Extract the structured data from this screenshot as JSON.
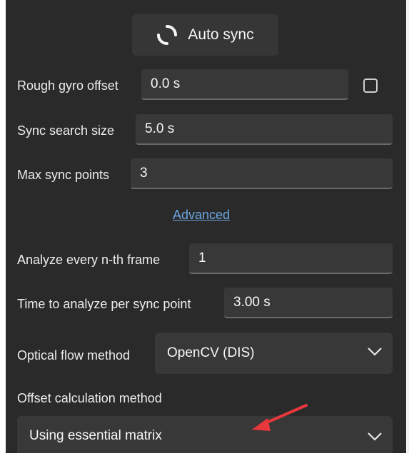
{
  "auto_sync": {
    "label": "Auto sync",
    "icon": "sync-spinner-icon"
  },
  "rough_gyro_offset": {
    "label": "Rough gyro offset",
    "value": "0.0 s"
  },
  "sync_search_size": {
    "label": "Sync search size",
    "value": "5.0 s"
  },
  "max_sync_points": {
    "label": "Max sync points",
    "value": "3"
  },
  "advanced": {
    "label": "Advanced"
  },
  "analyze_every": {
    "label": "Analyze every n-th frame",
    "value": "1"
  },
  "time_per_point": {
    "label": "Time to analyze per sync point",
    "value": "3.00 s"
  },
  "optical_flow": {
    "label": "Optical flow method",
    "selected": "OpenCV (DIS)"
  },
  "offset_calc": {
    "label": "Offset calculation method",
    "selected": "Using essential matrix"
  },
  "colors": {
    "panel": "#2a2a2a",
    "field": "#383838",
    "link": "#6ba6e0",
    "annotation_arrow": "#e8383d"
  }
}
